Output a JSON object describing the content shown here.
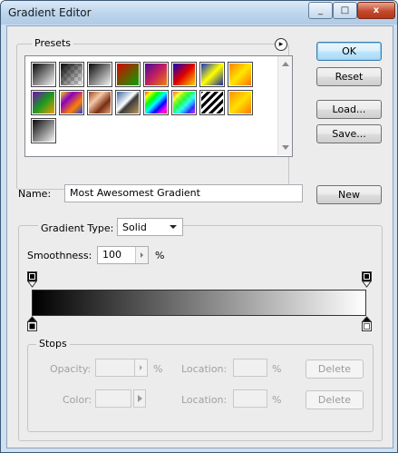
{
  "window": {
    "title": "Gradient Editor"
  },
  "titlebar": {
    "minimize_glyph": "_",
    "maximize_glyph": "□",
    "close_glyph": "x"
  },
  "presets": {
    "label": "Presets",
    "menu_arrow": "▸",
    "swatches": [
      {
        "name": "foreground-to-background"
      },
      {
        "name": "foreground-to-transparent"
      },
      {
        "name": "black-white"
      },
      {
        "name": "red-green"
      },
      {
        "name": "violet-orange"
      },
      {
        "name": "blue-red-yellow"
      },
      {
        "name": "blue-yellow-blue"
      },
      {
        "name": "orange-yellow-orange"
      },
      {
        "name": "violet-green-orange"
      },
      {
        "name": "yellow-violet-orange-blue"
      },
      {
        "name": "copper"
      },
      {
        "name": "chrome"
      },
      {
        "name": "spectrum"
      },
      {
        "name": "transparent-rainbow"
      },
      {
        "name": "transparent-stripes"
      },
      {
        "name": "orange-yellow-orange-2"
      },
      {
        "name": "black-white-selected"
      }
    ]
  },
  "buttons": {
    "ok": "OK",
    "reset": "Reset",
    "load": "Load...",
    "save": "Save...",
    "new": "New"
  },
  "name_field": {
    "label": "Name:",
    "value": "Most Awesomest Gradient"
  },
  "gradient": {
    "type_label": "Gradient Type:",
    "type_value": "Solid",
    "smoothness_label": "Smoothness:",
    "smoothness_value": "100",
    "smoothness_unit": "%",
    "colors": {
      "start": "#000000",
      "end": "#ffffff"
    }
  },
  "stops": {
    "label": "Stops",
    "opacity_label": "Opacity:",
    "opacity_unit": "%",
    "color_label": "Color:",
    "location_label": "Location:",
    "location_unit": "%",
    "delete_label": "Delete"
  }
}
